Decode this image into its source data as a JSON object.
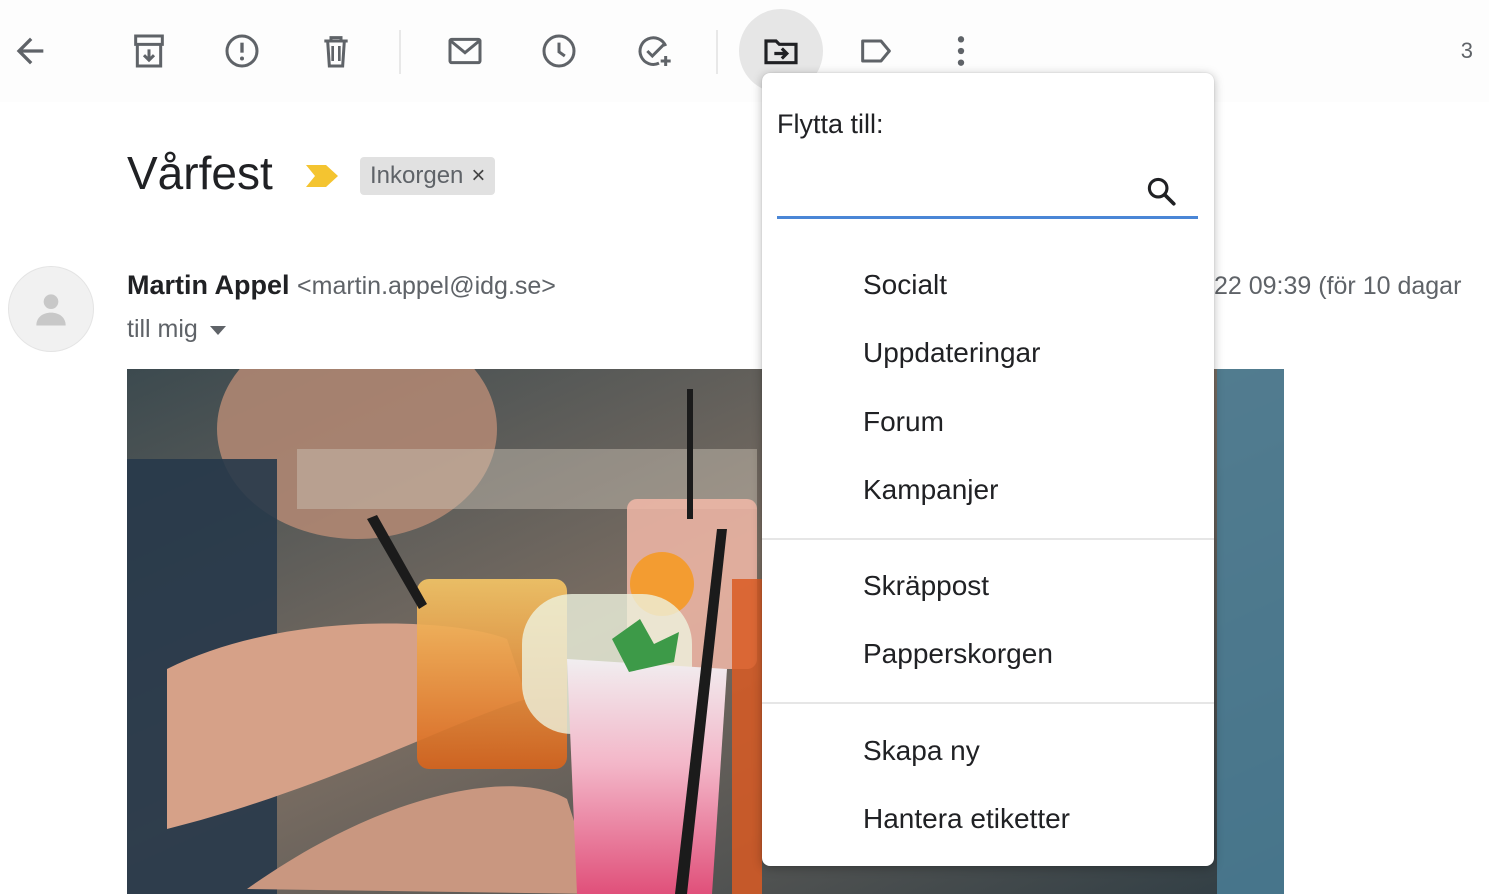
{
  "toolbar": {
    "buttons": [
      {
        "name": "back",
        "icon": "arrow-left-icon"
      },
      {
        "name": "archive",
        "icon": "archive-icon"
      },
      {
        "name": "report-spam",
        "icon": "alert-circle-icon"
      },
      {
        "name": "delete",
        "icon": "trash-icon"
      },
      {
        "name": "mark-unread",
        "icon": "envelope-icon"
      },
      {
        "name": "snooze",
        "icon": "clock-icon"
      },
      {
        "name": "add-to-tasks",
        "icon": "task-add-icon"
      },
      {
        "name": "move-to",
        "icon": "folder-move-icon"
      },
      {
        "name": "labels",
        "icon": "label-icon"
      },
      {
        "name": "more",
        "icon": "more-vert-icon"
      }
    ],
    "count_text": "3"
  },
  "email": {
    "subject": "Vårfest",
    "label_chip": "Inkorgen",
    "label_chip_remove": "×",
    "sender_name": "Martin Appel",
    "sender_email": "<martin.appel@idg.se>",
    "to_text": "till mig",
    "date_text": "22 09:39 (för 10 dagar"
  },
  "move_menu": {
    "title": "Flytta till:",
    "search_value": "",
    "items_group1": [
      "Socialt",
      "Uppdateringar",
      "Forum",
      "Kampanjer"
    ],
    "items_group2": [
      "Skräppost",
      "Papperskorgen"
    ],
    "items_group3": [
      "Skapa ny",
      "Hantera etiketter"
    ]
  },
  "colors": {
    "accent_blue": "#4a86d6",
    "importance_yellow": "#f4c430",
    "icon_gray": "#5f6368",
    "active_button_bg": "#e6e6e6"
  }
}
